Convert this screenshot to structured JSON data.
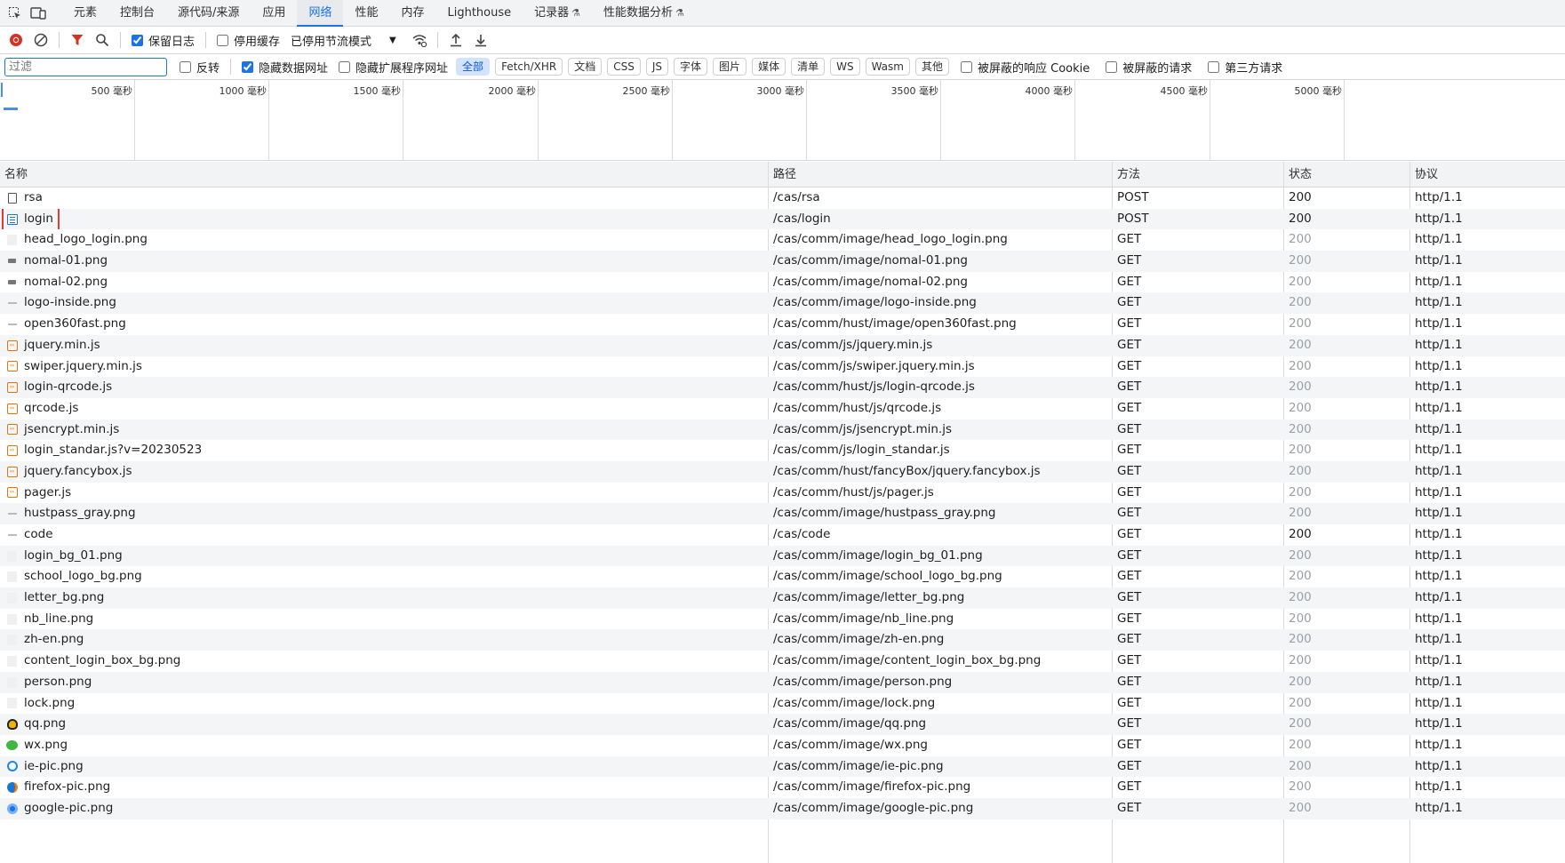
{
  "tabs": [
    {
      "label": "元素",
      "active": false
    },
    {
      "label": "控制台",
      "active": false
    },
    {
      "label": "源代码/来源",
      "active": false
    },
    {
      "label": "应用",
      "active": false
    },
    {
      "label": "网络",
      "active": true
    },
    {
      "label": "性能",
      "active": false
    },
    {
      "label": "内存",
      "active": false
    },
    {
      "label": "Lighthouse",
      "active": false
    },
    {
      "label": "记录器",
      "active": false,
      "flask": true
    },
    {
      "label": "性能数据分析",
      "active": false,
      "flask": true
    }
  ],
  "toolbar": {
    "preserve_log_label": "保留日志",
    "preserve_log_checked": true,
    "disable_cache_label": "停用缓存",
    "disable_cache_checked": false,
    "throttling_label": "已停用节流模式"
  },
  "filter": {
    "placeholder": "过滤",
    "invert_label": "反转",
    "hide_data_urls_label": "隐藏数据网址",
    "hide_extension_urls_label": "隐藏扩展程序网址",
    "types": [
      {
        "label": "全部",
        "active": true
      },
      {
        "label": "Fetch/XHR",
        "active": false
      },
      {
        "label": "文档",
        "active": false
      },
      {
        "label": "CSS",
        "active": false
      },
      {
        "label": "JS",
        "active": false
      },
      {
        "label": "字体",
        "active": false
      },
      {
        "label": "图片",
        "active": false
      },
      {
        "label": "媒体",
        "active": false
      },
      {
        "label": "清单",
        "active": false
      },
      {
        "label": "WS",
        "active": false
      },
      {
        "label": "Wasm",
        "active": false
      },
      {
        "label": "其他",
        "active": false
      }
    ],
    "blocked_cookies_label": "被屏蔽的响应 Cookie",
    "blocked_requests_label": "被屏蔽的请求",
    "third_party_label": "第三方请求"
  },
  "overview": {
    "ticks": [
      "500 毫秒",
      "1000 毫秒",
      "1500 毫秒",
      "2000 毫秒",
      "2500 毫秒",
      "3000 毫秒",
      "3500 毫秒",
      "4000 毫秒",
      "4500 毫秒",
      "5000 毫秒"
    ]
  },
  "table": {
    "headers": {
      "name": "名称",
      "path": "路径",
      "method": "方法",
      "status": "状态",
      "protocol": "协议"
    },
    "rows": [
      {
        "name": "rsa",
        "path": "/cas/rsa",
        "method": "POST",
        "status": "200",
        "protocol": "http/1.1",
        "icon": "document-icon",
        "cached": false
      },
      {
        "name": "login",
        "path": "/cas/login",
        "method": "POST",
        "status": "200",
        "protocol": "http/1.1",
        "icon": "page-icon",
        "cached": false,
        "highlighted": true
      },
      {
        "name": "head_logo_login.png",
        "path": "/cas/comm/image/head_logo_login.png",
        "method": "GET",
        "status": "200",
        "protocol": "http/1.1",
        "icon": "image-blank-icon",
        "cached": true
      },
      {
        "name": "nomal-01.png",
        "path": "/cas/comm/image/nomal-01.png",
        "method": "GET",
        "status": "200",
        "protocol": "http/1.1",
        "icon": "image-grey-icon",
        "cached": true
      },
      {
        "name": "nomal-02.png",
        "path": "/cas/comm/image/nomal-02.png",
        "method": "GET",
        "status": "200",
        "protocol": "http/1.1",
        "icon": "image-grey-icon",
        "cached": true
      },
      {
        "name": "logo-inside.png",
        "path": "/cas/comm/image/logo-inside.png",
        "method": "GET",
        "status": "200",
        "protocol": "http/1.1",
        "icon": "image-dash-icon",
        "cached": true
      },
      {
        "name": "open360fast.png",
        "path": "/cas/comm/hust/image/open360fast.png",
        "method": "GET",
        "status": "200",
        "protocol": "http/1.1",
        "icon": "image-dash-icon",
        "cached": true
      },
      {
        "name": "jquery.min.js",
        "path": "/cas/comm/js/jquery.min.js",
        "method": "GET",
        "status": "200",
        "protocol": "http/1.1",
        "icon": "script-icon",
        "cached": true
      },
      {
        "name": "swiper.jquery.min.js",
        "path": "/cas/comm/js/swiper.jquery.min.js",
        "method": "GET",
        "status": "200",
        "protocol": "http/1.1",
        "icon": "script-icon",
        "cached": true
      },
      {
        "name": "login-qrcode.js",
        "path": "/cas/comm/hust/js/login-qrcode.js",
        "method": "GET",
        "status": "200",
        "protocol": "http/1.1",
        "icon": "script-icon",
        "cached": true
      },
      {
        "name": "qrcode.js",
        "path": "/cas/comm/hust/js/qrcode.js",
        "method": "GET",
        "status": "200",
        "protocol": "http/1.1",
        "icon": "script-icon",
        "cached": true
      },
      {
        "name": "jsencrypt.min.js",
        "path": "/cas/comm/js/jsencrypt.min.js",
        "method": "GET",
        "status": "200",
        "protocol": "http/1.1",
        "icon": "script-icon",
        "cached": true
      },
      {
        "name": "login_standar.js?v=20230523",
        "path": "/cas/comm/js/login_standar.js",
        "method": "GET",
        "status": "200",
        "protocol": "http/1.1",
        "icon": "script-icon",
        "cached": true
      },
      {
        "name": "jquery.fancybox.js",
        "path": "/cas/comm/hust/fancyBox/jquery.fancybox.js",
        "method": "GET",
        "status": "200",
        "protocol": "http/1.1",
        "icon": "script-icon",
        "cached": true
      },
      {
        "name": "pager.js",
        "path": "/cas/comm/hust/js/pager.js",
        "method": "GET",
        "status": "200",
        "protocol": "http/1.1",
        "icon": "script-icon",
        "cached": true
      },
      {
        "name": "hustpass_gray.png",
        "path": "/cas/comm/image/hustpass_gray.png",
        "method": "GET",
        "status": "200",
        "protocol": "http/1.1",
        "icon": "image-dash-icon",
        "cached": true
      },
      {
        "name": "code",
        "path": "/cas/code",
        "method": "GET",
        "status": "200",
        "protocol": "http/1.1",
        "icon": "image-dash-icon",
        "cached": false
      },
      {
        "name": "login_bg_01.png",
        "path": "/cas/comm/image/login_bg_01.png",
        "method": "GET",
        "status": "200",
        "protocol": "http/1.1",
        "icon": "image-blank-icon",
        "cached": true
      },
      {
        "name": "school_logo_bg.png",
        "path": "/cas/comm/image/school_logo_bg.png",
        "method": "GET",
        "status": "200",
        "protocol": "http/1.1",
        "icon": "image-blank-icon",
        "cached": true
      },
      {
        "name": "letter_bg.png",
        "path": "/cas/comm/image/letter_bg.png",
        "method": "GET",
        "status": "200",
        "protocol": "http/1.1",
        "icon": "image-blank-icon",
        "cached": true
      },
      {
        "name": "nb_line.png",
        "path": "/cas/comm/image/nb_line.png",
        "method": "GET",
        "status": "200",
        "protocol": "http/1.1",
        "icon": "image-blank-icon",
        "cached": true
      },
      {
        "name": "zh-en.png",
        "path": "/cas/comm/image/zh-en.png",
        "method": "GET",
        "status": "200",
        "protocol": "http/1.1",
        "icon": "image-blank-icon",
        "cached": true
      },
      {
        "name": "content_login_box_bg.png",
        "path": "/cas/comm/image/content_login_box_bg.png",
        "method": "GET",
        "status": "200",
        "protocol": "http/1.1",
        "icon": "image-blank-icon",
        "cached": true
      },
      {
        "name": "person.png",
        "path": "/cas/comm/image/person.png",
        "method": "GET",
        "status": "200",
        "protocol": "http/1.1",
        "icon": "image-blank-icon",
        "cached": true
      },
      {
        "name": "lock.png",
        "path": "/cas/comm/image/lock.png",
        "method": "GET",
        "status": "200",
        "protocol": "http/1.1",
        "icon": "image-blank-icon",
        "cached": true
      },
      {
        "name": "qq.png",
        "path": "/cas/comm/image/qq.png",
        "method": "GET",
        "status": "200",
        "protocol": "http/1.1",
        "icon": "qq-icon",
        "cached": true
      },
      {
        "name": "wx.png",
        "path": "/cas/comm/image/wx.png",
        "method": "GET",
        "status": "200",
        "protocol": "http/1.1",
        "icon": "wechat-icon",
        "cached": true
      },
      {
        "name": "ie-pic.png",
        "path": "/cas/comm/image/ie-pic.png",
        "method": "GET",
        "status": "200",
        "protocol": "http/1.1",
        "icon": "ie-icon",
        "cached": true
      },
      {
        "name": "firefox-pic.png",
        "path": "/cas/comm/image/firefox-pic.png",
        "method": "GET",
        "status": "200",
        "protocol": "http/1.1",
        "icon": "firefox-icon",
        "cached": true
      },
      {
        "name": "google-pic.png",
        "path": "/cas/comm/image/google-pic.png",
        "method": "GET",
        "status": "200",
        "protocol": "http/1.1",
        "icon": "chrome-icon",
        "cached": true
      }
    ]
  },
  "colors": {
    "accent": "#1a73e8",
    "record_red": "#d93025",
    "highlight_red": "#e53935",
    "script_orange": "#e8710a"
  }
}
